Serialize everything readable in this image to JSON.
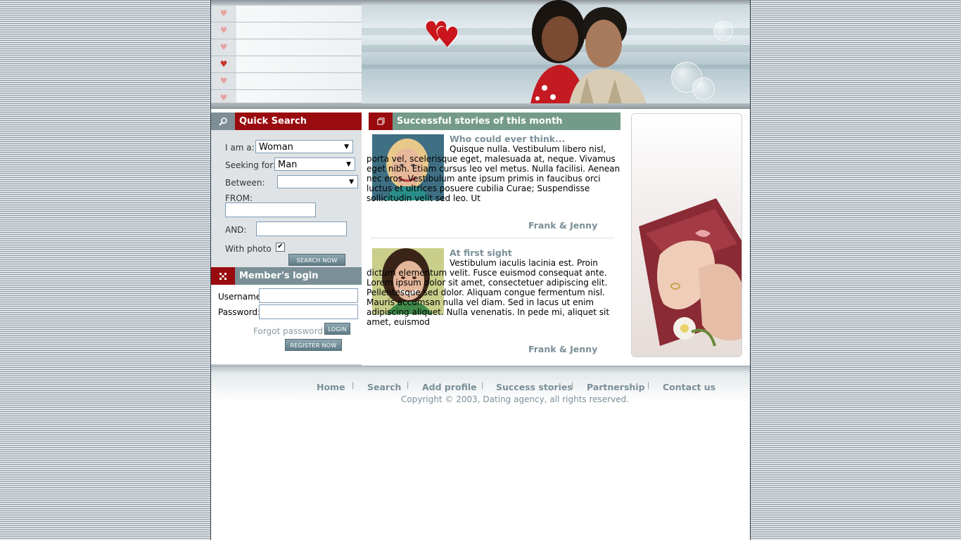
{
  "quick_search": {
    "title": "Quick Search",
    "i_am_label": "I am a:",
    "i_am_value": "Woman",
    "seeking_label": "Seeking for:",
    "seeking_value": "Man",
    "between_label": "Between:",
    "between_value": "",
    "from_label": "FROM:",
    "and_label": "AND:",
    "photo_label": "With photo",
    "photo_checked": "✔",
    "search_button": "SEARCH NOW"
  },
  "member_login": {
    "title": "Member's login",
    "username_label": "Username:",
    "password_label": "Password:",
    "forgot_label": "Forgot password?",
    "login_button": "LOGIN",
    "register_button": "REGISTER NOW"
  },
  "stories": {
    "title": "Successful stories of this month",
    "items": [
      {
        "title": "Who could ever think...",
        "text": "Quisque nulla. Vestibulum libero nisl, porta vel, scelerisque eget, malesuada at, neque. Vivamus eget nibh. Etiam cursus leo vel metus. Nulla facilisi. Aenean nec eros. Vestibulum ante ipsum primis in faucibus orci luctus et ultrices posuere cubilia Curae; Suspendisse sollicitudin velit sed leo. Ut",
        "sign": "Frank & Jenny"
      },
      {
        "title": "At first sight",
        "text": "Vestibulum iaculis lacinia est. Proin dictum elementum velit. Fusce euismod consequat ante. Lorem ipsum dolor sit amet, consectetuer adipiscing elit. Pellentesque sed dolor. Aliquam congue fermentum nisl. Mauris accumsan nulla vel diam. Sed in lacus ut enim adipiscing aliquet. Nulla venenatis. In pede mi, aliquet sit amet, euismod",
        "sign": "Frank & Jenny"
      }
    ]
  },
  "footer": {
    "nav": [
      "Home",
      "Search",
      "Add profile",
      "Success stories",
      "Partnership",
      "Contact us"
    ],
    "separator": "|",
    "copyright": "Copyright © 2003, Dating agency, all rights reserved."
  },
  "icons": {
    "menu": "heart-icon",
    "quick_search": "magnifier-icon",
    "member_login": "grid-icon",
    "stories": "copy-icon"
  }
}
